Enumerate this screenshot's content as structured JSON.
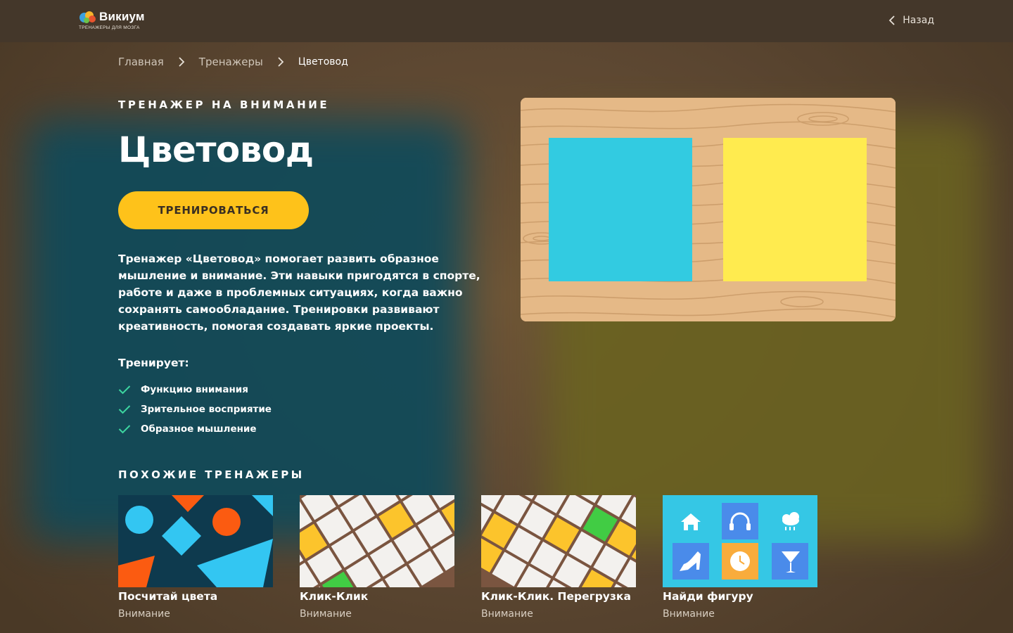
{
  "header": {
    "logo_title": "Викиум",
    "logo_subtitle": "ТРЕНАЖЕРЫ ДЛЯ МОЗГА",
    "back_label": "Назад"
  },
  "breadcrumb": {
    "items": [
      "Главная",
      "Тренажеры",
      "Цветовод"
    ]
  },
  "hero": {
    "eyebrow": "ТРЕНАЖЕР НА ВНИМАНИЕ",
    "title": "Цветовод",
    "cta_label": "ТРЕНИРОВАТЬСЯ",
    "description": "Тренажер «Цветовод» помогает развить образное мышление и внимание. Эти навыки пригодятся в спорте, работе и даже в проблемных ситуациях, когда важно сохранять самообладание. Тренировки развивают креативность, помогая создавать яркие проекты."
  },
  "trains": {
    "label": "Тренирует:",
    "items": [
      "Функцию внимания",
      "Зрительное восприятие",
      "Образное мышление"
    ]
  },
  "preview": {
    "left_color": "#32cbe1",
    "right_color": "#ffeb4f",
    "wood_color": "#e5b987"
  },
  "similar": {
    "title": "ПОХОЖИЕ ТРЕНАЖЕРЫ",
    "cards": [
      {
        "name": "Посчитай цвета",
        "category": "Внимание"
      },
      {
        "name": "Клик-Клик",
        "category": "Внимание"
      },
      {
        "name": "Клик-Клик. Перегрузка",
        "category": "Внимание"
      },
      {
        "name": "Найди фигуру",
        "category": "Внимание"
      }
    ]
  },
  "colors": {
    "accent": "#fec21a",
    "check": "#3dd6a0",
    "topbar": "#44372a"
  }
}
